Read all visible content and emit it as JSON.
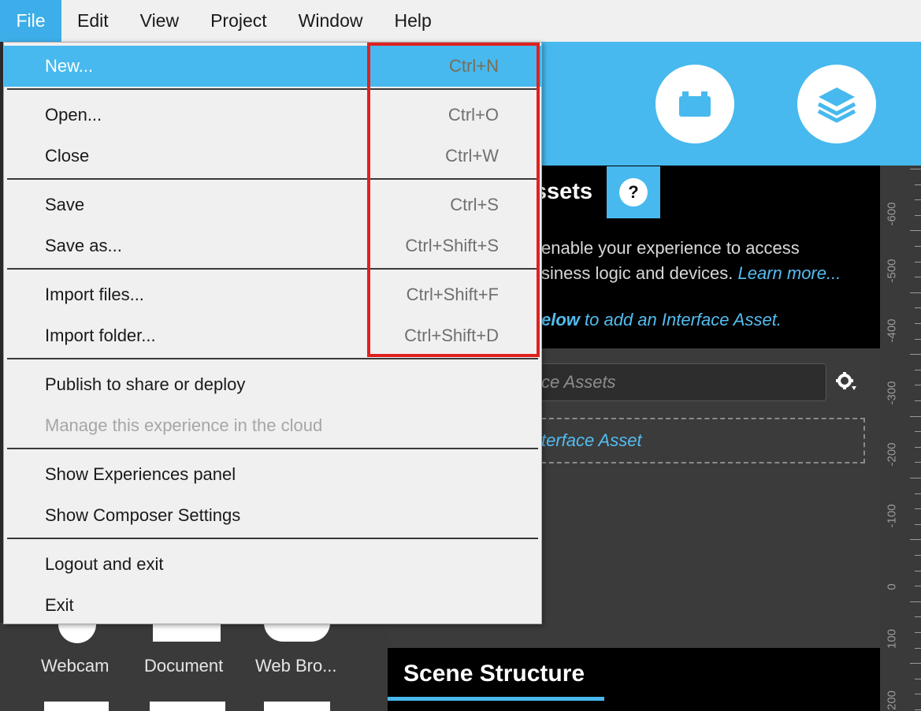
{
  "menubar": {
    "items": [
      {
        "label": "File"
      },
      {
        "label": "Edit"
      },
      {
        "label": "View"
      },
      {
        "label": "Project"
      },
      {
        "label": "Window"
      },
      {
        "label": "Help"
      }
    ]
  },
  "file_menu": {
    "items": [
      {
        "label": "New...",
        "shortcut": "Ctrl+N"
      },
      {
        "label": "Open...",
        "shortcut": "Ctrl+O"
      },
      {
        "label": "Close",
        "shortcut": "Ctrl+W"
      },
      {
        "label": "Save",
        "shortcut": "Ctrl+S"
      },
      {
        "label": "Save as...",
        "shortcut": "Ctrl+Shift+S"
      },
      {
        "label": "Import files...",
        "shortcut": "Ctrl+Shift+F"
      },
      {
        "label": "Import folder...",
        "shortcut": "Ctrl+Shift+D"
      },
      {
        "label": "Publish to share or deploy"
      },
      {
        "label": "Manage this experience in the cloud"
      },
      {
        "label": "Show Experiences panel"
      },
      {
        "label": "Show Composer Settings"
      },
      {
        "label": "Logout and exit"
      },
      {
        "label": "Exit"
      }
    ]
  },
  "assets_panel": {
    "title_fragment": "ssets",
    "help_label": "?",
    "desc_line1": "enable your experience to access",
    "desc_line2": "siness logic and devices.",
    "learn_more": "Learn more...",
    "below_bold": "elow",
    "below_rest": " to add an Interface Asset.",
    "search_placeholder": "ce Assets",
    "add_label": "terface Asset"
  },
  "scene": {
    "title": "Scene Structure"
  },
  "ruler": {
    "labels": [
      "-600",
      "-500",
      "-400",
      "-300",
      "-200",
      "-100",
      "0",
      "100",
      "200"
    ]
  },
  "asset_tiles": [
    {
      "label": "Webcam"
    },
    {
      "label": "Document"
    },
    {
      "label": "Web Bro..."
    }
  ],
  "colors": {
    "accent": "#47b9ee",
    "highlight_border": "#e02020"
  }
}
